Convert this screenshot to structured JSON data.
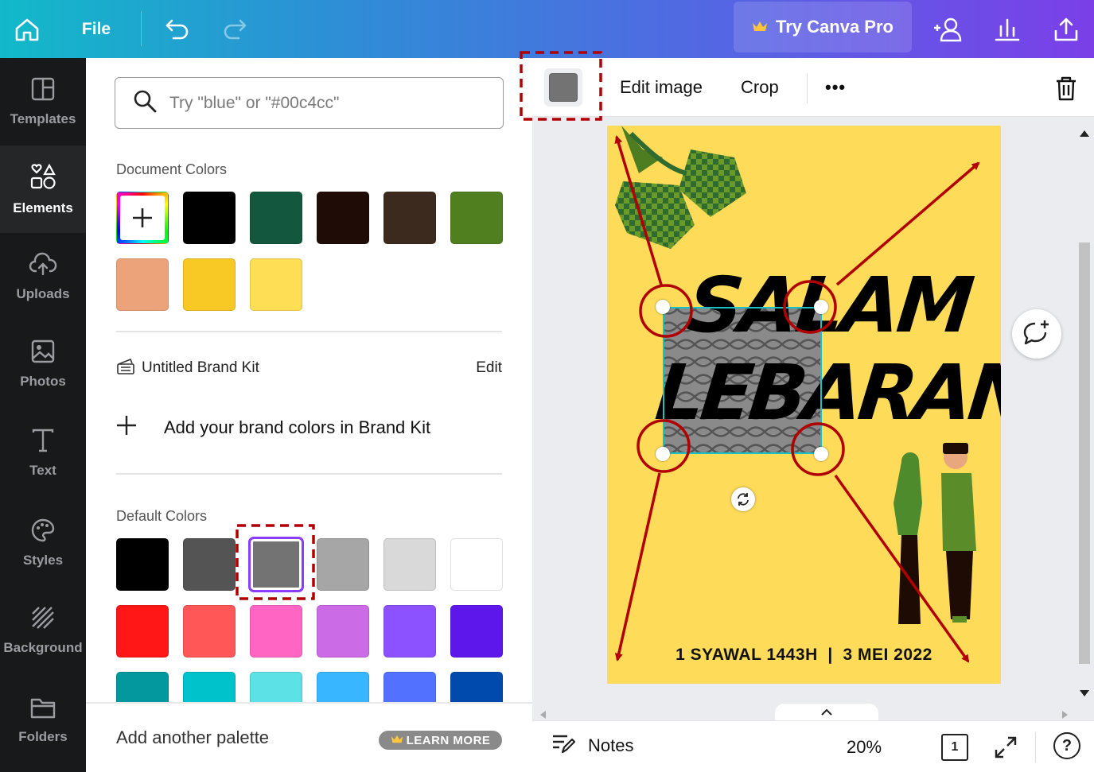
{
  "topbar": {
    "file_label": "File",
    "pro_label": "Try Canva Pro",
    "icons": [
      "home-icon",
      "undo-icon",
      "redo-icon",
      "crown-icon",
      "share-people-icon",
      "insights-icon",
      "upload-icon"
    ]
  },
  "sidebar": {
    "items": [
      {
        "label": "Templates",
        "icon": "templates-icon"
      },
      {
        "label": "Elements",
        "icon": "elements-icon"
      },
      {
        "label": "Uploads",
        "icon": "cloud-upload-icon"
      },
      {
        "label": "Photos",
        "icon": "photo-icon"
      },
      {
        "label": "Text",
        "icon": "text-icon"
      },
      {
        "label": "Styles",
        "icon": "palette-icon"
      },
      {
        "label": "Background",
        "icon": "background-icon"
      },
      {
        "label": "Folders",
        "icon": "folder-icon"
      }
    ]
  },
  "color_panel": {
    "search_placeholder": "Try \"blue\" or \"#00c4cc\"",
    "document_colors_title": "Document Colors",
    "document_colors": [
      "#000000",
      "#14573f",
      "#1f0c06",
      "#3c2a1f",
      "#507f1f",
      "#eda37a",
      "#f8c825",
      "#fede55"
    ],
    "brand_kit_name": "Untitled Brand Kit",
    "brand_kit_edit": "Edit",
    "add_brand_colors": "Add your brand colors in Brand Kit",
    "default_colors_title": "Default Colors",
    "default_colors": [
      "#000000",
      "#545454",
      "#737373",
      "#a6a6a6",
      "#d9d9d9",
      "#ffffff",
      "#ff1616",
      "#ff5757",
      "#ff66c4",
      "#cb6ce6",
      "#8c52ff",
      "#5e17eb",
      "#03989e",
      "#00c2cb",
      "#5ce1e6",
      "#38b6ff",
      "#5271ff",
      "#004aad"
    ],
    "selected_color": "#737373",
    "add_palette": "Add another palette",
    "learn_more": "LEARN MORE"
  },
  "context_toolbar": {
    "color_swatch": "#737373",
    "edit_image": "Edit image",
    "crop": "Crop",
    "more": "•••"
  },
  "design": {
    "title_line1": "SALAM",
    "title_line2": "LEBARAN",
    "date_text": "1 SYAWAL 1443H  |  3 MEI 2022",
    "background": "#fedc5a"
  },
  "bottom_bar": {
    "notes": "Notes",
    "zoom": "20%",
    "page_number": "1",
    "help": "?"
  },
  "annotations": {
    "color": "#b00000"
  }
}
